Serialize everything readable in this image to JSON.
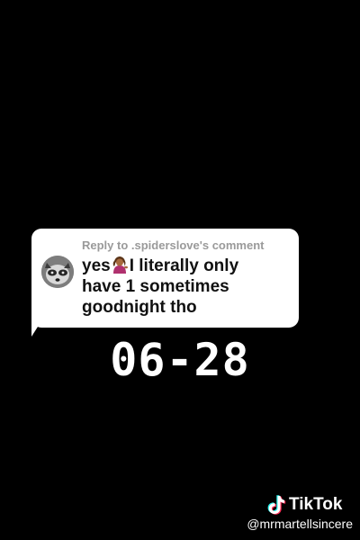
{
  "comment": {
    "reply_header": "Reply to .spiderslove's comment",
    "line1_after_emoji": "I literally only",
    "line1_before_emoji": "yes",
    "line2": "have 1 sometimes",
    "line3": "goodnight tho",
    "avatar_icon": "raccoon-avatar-icon",
    "emoji_icon": "person-tipping-hand-emoji"
  },
  "overlay": {
    "date": "06-28"
  },
  "watermark": {
    "brand": "TikTok",
    "handle": "@mrmartellsincere",
    "logo_icon": "tiktok-logo-icon"
  }
}
